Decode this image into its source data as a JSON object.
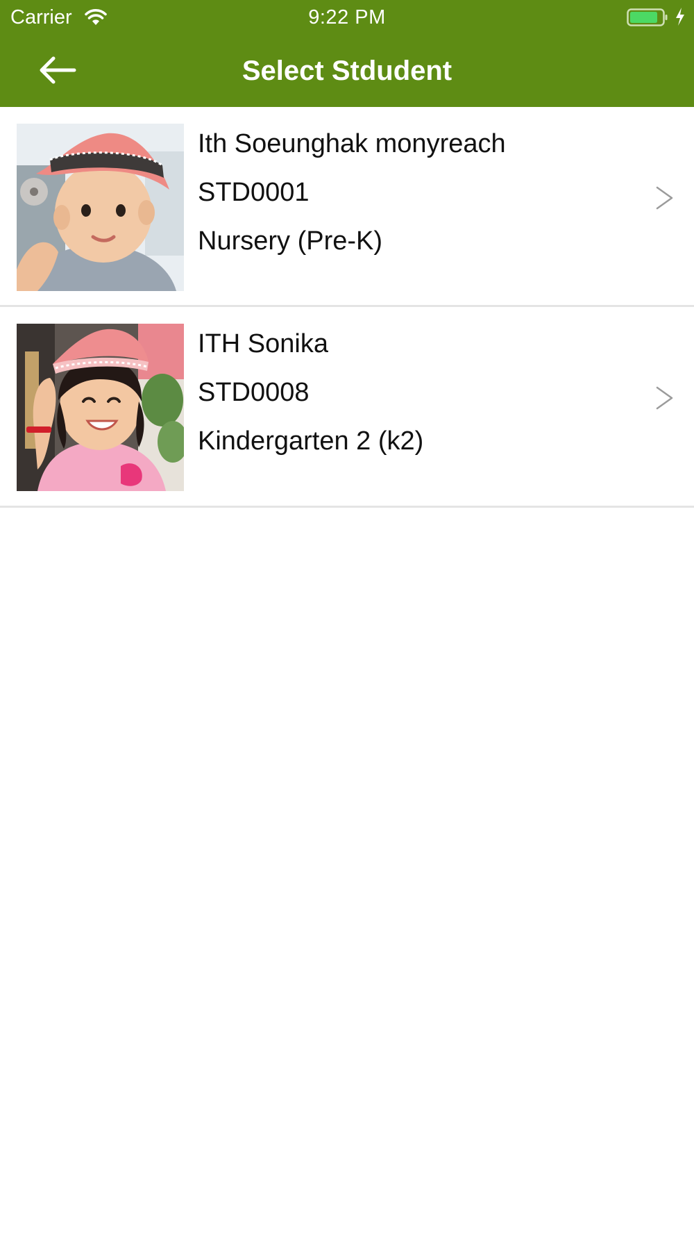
{
  "status_bar": {
    "carrier": "Carrier",
    "time": "9:22 PM",
    "battery_color": "#4cd964"
  },
  "nav": {
    "title": "Select Stdudent",
    "back_icon": "arrow-left-icon",
    "background_color": "#5e8c14"
  },
  "students": [
    {
      "name": "Ith Soeunghak monyreach",
      "id": "STD0001",
      "class": "Nursery (Pre-K)",
      "chevron_icon": "chevron-right-icon"
    },
    {
      "name": "ITH Sonika",
      "id": "STD0008",
      "class": "Kindergarten 2 (k2)",
      "chevron_icon": "chevron-right-icon"
    }
  ]
}
